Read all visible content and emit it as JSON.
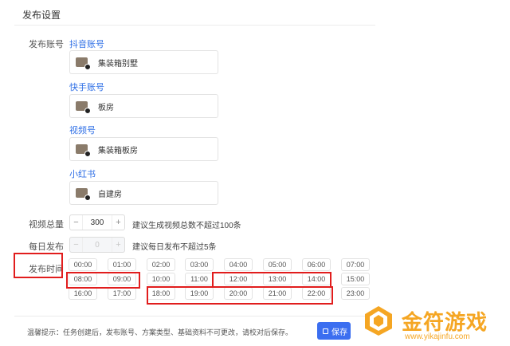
{
  "header": {
    "title": "发布设置"
  },
  "publish_account": {
    "label": "发布账号",
    "platforms": [
      {
        "name": "抖音账号",
        "account": "集装箱别墅"
      },
      {
        "name": "快手账号",
        "account": "板房"
      },
      {
        "name": "视频号",
        "account": "集装箱板房"
      },
      {
        "name": "小红书",
        "account": "自建房"
      }
    ]
  },
  "video_total": {
    "label": "视频总量",
    "minus": "−",
    "value": "300",
    "plus": "+",
    "hint": "建议生成视频总数不超过100条"
  },
  "daily_publish": {
    "label": "每日发布",
    "minus": "−",
    "value": "0",
    "plus": "+",
    "hint": "建议每日发布不超过5条"
  },
  "publish_time": {
    "label": "发布时间",
    "slots": [
      "00:00",
      "01:00",
      "02:00",
      "03:00",
      "04:00",
      "05:00",
      "06:00",
      "07:00",
      "08:00",
      "09:00",
      "10:00",
      "11:00",
      "12:00",
      "13:00",
      "14:00",
      "15:00",
      "16:00",
      "17:00",
      "18:00",
      "19:00",
      "20:00",
      "21:00",
      "22:00",
      "23:00"
    ],
    "highlighted": [
      "08:00",
      "09:00",
      "12:00",
      "13:00",
      "14:00",
      "18:00",
      "19:00",
      "20:00",
      "21:00",
      "22:00"
    ]
  },
  "footer": {
    "tip": "温馨提示：任务创建后，发布账号、方案类型、基础资料不可更改，请校对后保存。",
    "save_label": "保存"
  },
  "watermark": {
    "title": "金符游戏",
    "url": "www.yikajinfu.com"
  },
  "colors": {
    "accent": "#3b6ef0",
    "link": "#2f6fe6",
    "highlight": "#e11d1d",
    "watermark": "#f5a623"
  }
}
